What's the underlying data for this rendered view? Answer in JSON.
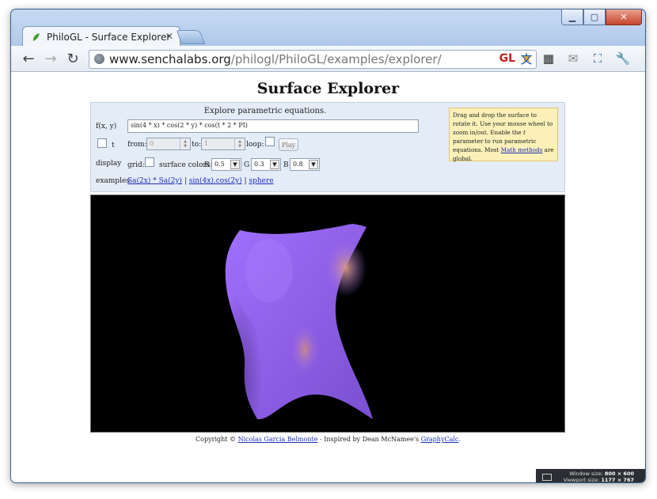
{
  "window": {
    "minimize": "▁",
    "maximize": "▢",
    "close": "✕"
  },
  "tab": {
    "title": "PhiloGL - Surface Explorer",
    "close": "✕"
  },
  "toolbar": {
    "back": "←",
    "forward": "→",
    "reload": "↻",
    "url_host": "www.senchalabs.org",
    "url_path": "/philogl/PhiloGL/examples/explorer/",
    "gl_badge": "GL",
    "star": "★",
    "ext_translate": "文",
    "ext_qr": "▦",
    "ext_mail": "✉",
    "ext_resize": "⛶",
    "wrench": "🔧"
  },
  "page": {
    "title": "Surface Explorer",
    "panel": {
      "subtitle": "Explore parametric equations.",
      "fxy_label": "f(x, y)",
      "fxy_value": "sin(4 * x) * cos(2 * y) * cos(t * 2 * PI)",
      "t_label": "t",
      "from_label": "from:",
      "from_value": "0",
      "to_label": "to:",
      "to_value": "1",
      "loop_label": "loop:",
      "play_label": "Play",
      "display_label": "display",
      "grid_label": "grid:",
      "colors_label": "surface colors:",
      "r_label": "R",
      "r_value": "0.5",
      "g_label": "G",
      "g_value": "0.3",
      "b_label": "B",
      "b_value": "0.8",
      "examples_label": "examples",
      "example1": "Sa(2x) * Sa(2y)",
      "example2": "sin(4x).cos(2y)",
      "example3": "sphere",
      "sep": "|"
    },
    "help": {
      "text1": "Drag and drop the surface to rotate it. Use your mouse wheel to zoom in/out. Enable the ",
      "t_param": "t",
      "text2": " parameter to run parametric equations. Most ",
      "math_link": "Math methods",
      "text3": " are global."
    },
    "copyright": {
      "prefix": "Copyright © ",
      "author": "Nicolas Garcia Belmonte",
      "middle": " - Inspired by Dean McNamee's ",
      "graphycalc": "GraphyCalc",
      "suffix": "."
    }
  },
  "sizebox": {
    "window_label": "Window size:",
    "window_value": "800 × 600",
    "viewport_label": "Viewport size:",
    "viewport_value": "1177 × 767"
  },
  "colors": {
    "surface": "#9a6ef0",
    "surface_highlight": "#d0908a",
    "canvas_bg": "#000000"
  }
}
